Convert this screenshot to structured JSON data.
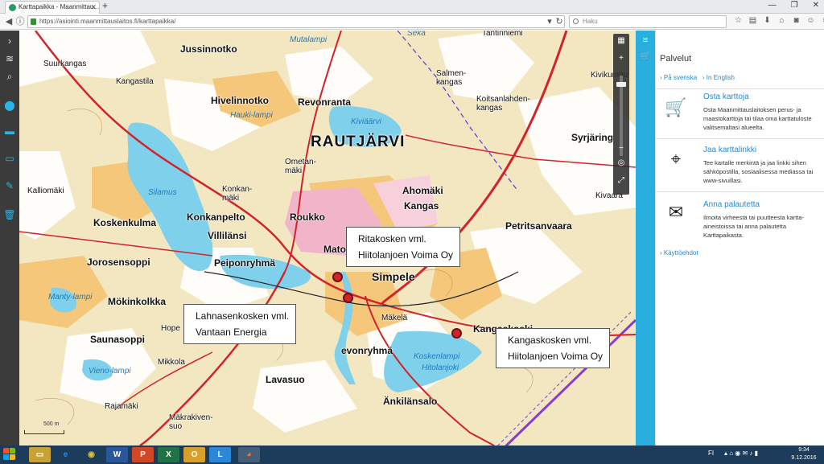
{
  "browser": {
    "tab_title": "Karttapaikka - Maanmittau...",
    "url": "https://asiointi.maanmittauslaitos.fi/karttapaikka/",
    "search_placeholder": "Haku"
  },
  "map": {
    "places": [
      {
        "name": "Suurkangas",
        "size": "small"
      },
      {
        "name": "Jussinnotko",
        "size": "normal"
      },
      {
        "name": "Kangastila",
        "size": "small"
      },
      {
        "name": "Hivelinnotko",
        "size": "normal"
      },
      {
        "name": "Revonranta",
        "size": "normal"
      },
      {
        "name": "RAUTJÄRVI",
        "size": "big"
      },
      {
        "name": "Kalliomäki",
        "size": "small"
      },
      {
        "name": "Koskenkulma",
        "size": "normal"
      },
      {
        "name": "Konkanpelto",
        "size": "normal"
      },
      {
        "name": "Villilänsi",
        "size": "normal"
      },
      {
        "name": "Roukko",
        "size": "normal"
      },
      {
        "name": "Ahomäki",
        "size": "normal"
      },
      {
        "name": "Kangas",
        "size": "normal"
      },
      {
        "name": "Syrjäring",
        "size": "normal"
      },
      {
        "name": "Petritsanvaara",
        "size": "normal"
      },
      {
        "name": "Jorosensoppi",
        "size": "normal"
      },
      {
        "name": "Peiponryhmä",
        "size": "normal"
      },
      {
        "name": "Mator",
        "size": "normal"
      },
      {
        "name": "Simpele",
        "size": "big2"
      },
      {
        "name": "Mökinkolkka",
        "size": "normal"
      },
      {
        "name": "Saunasoppi",
        "size": "normal"
      },
      {
        "name": "Hope",
        "size": "small"
      },
      {
        "name": "Mikkola",
        "size": "small"
      },
      {
        "name": "Mäkelä",
        "size": "small"
      },
      {
        "name": "Kangaskoski",
        "size": "normal"
      },
      {
        "name": "evonryhmä",
        "size": "normal"
      },
      {
        "name": "Lavasuo",
        "size": "normal"
      },
      {
        "name": "Rajamäki",
        "size": "small"
      },
      {
        "name": "Änkilänsalo",
        "size": "normal"
      },
      {
        "name": "Salmen-kangas",
        "size": "small"
      },
      {
        "name": "Koitsanlahden-kangas",
        "size": "small"
      },
      {
        "name": "Kivikumpu",
        "size": "small"
      },
      {
        "name": "Tantinniemi",
        "size": "small"
      },
      {
        "name": "Ometan-mäki",
        "size": "small"
      },
      {
        "name": "Konkan-mäki",
        "size": "small"
      },
      {
        "name": "Kivaara",
        "size": "small"
      },
      {
        "name": "Mäkrakiven-suo",
        "size": "small"
      }
    ],
    "water_names": [
      "Mutalampi",
      "Kiviäärvi",
      "Hauki-lampi",
      "Silamus",
      "Manty-lampi",
      "Koskenlampi",
      "Hitolanjoki",
      "Vieno-lampi",
      "Seka"
    ],
    "callouts": [
      {
        "line1": "Ritakosken vml.",
        "line2": "Hiitolanjoen Voima Oy"
      },
      {
        "line1": "Lahnasenkosken vml.",
        "line2": "Vantaan Energia"
      },
      {
        "line1": "Kangaskosken vml.",
        "line2": "Hiitolanjoen Voima Oy"
      }
    ],
    "scale_label": "500 m"
  },
  "panel": {
    "title": "Palvelut",
    "lang_sv": "› På svenska",
    "lang_en": "› In English",
    "items": [
      {
        "icon": "cart-icon",
        "title": "Osta karttoja",
        "desc": "Osta Maanmittauslaitoksen perus- ja maastokarttoja tai tilaa oma karttatuloste valitsemaltasi alueelta."
      },
      {
        "icon": "share-link-icon",
        "title": "Jaa karttalinkki",
        "desc": "Tee kartalle merkintä ja jaa linkki sihen sähköpostilla, sosiaalisessa mediassa tai www-sivuillasi."
      },
      {
        "icon": "feedback-mail-icon",
        "title": "Anna palautetta",
        "desc": "Ilmoita virheestä tai puutteesta kartta-aineistoissa tai anna palautetta Karttapaikasta."
      }
    ],
    "terms": "› Käyttöehdot"
  },
  "taskbar": {
    "lang": "FI",
    "time": "9:34",
    "date": "9.12.2016"
  },
  "colors": {
    "map_base": "#f3e7c2",
    "field": "#f4c77a",
    "forest": "#ffffff",
    "water": "#7fd0ea",
    "road": "#d2232a",
    "panel_accent": "#29aee0",
    "taskbar": "#1d3c5c"
  }
}
